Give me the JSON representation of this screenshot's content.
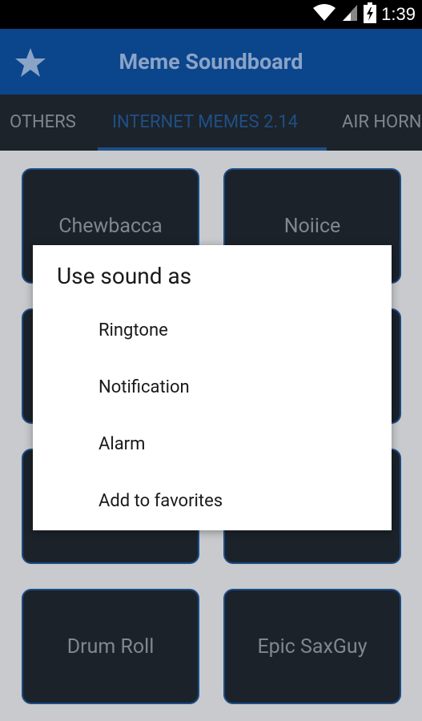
{
  "status_bar": {
    "time": "1:39",
    "icons": [
      "wifi-icon",
      "signal-icon",
      "battery-icon"
    ]
  },
  "app_bar": {
    "title": "Meme Soundboard",
    "icon": "star-icon",
    "color": "#0b458c"
  },
  "tabs": [
    {
      "label": "OTHERS",
      "selected": false
    },
    {
      "label": "INTERNET MEMES 2.14",
      "selected": true
    },
    {
      "label": "AIR HORN",
      "selected": false
    }
  ],
  "sound_tiles": [
    {
      "label": "Chewbacca"
    },
    {
      "label": "Noiice"
    },
    {
      "label": ""
    },
    {
      "label": ""
    },
    {
      "label": ""
    },
    {
      "label": ""
    },
    {
      "label": "Drum Roll"
    },
    {
      "label": "Epic SaxGuy"
    }
  ],
  "dialog": {
    "title": "Use sound as",
    "items": [
      {
        "label": "Ringtone"
      },
      {
        "label": "Notification"
      },
      {
        "label": "Alarm"
      },
      {
        "label": "Add to favorites"
      }
    ]
  },
  "colors": {
    "tile_bg": "#1b222a",
    "tile_border": "#1b4c85",
    "tab_bar_bg": "#1c232b",
    "accent": "#1f4f86"
  }
}
